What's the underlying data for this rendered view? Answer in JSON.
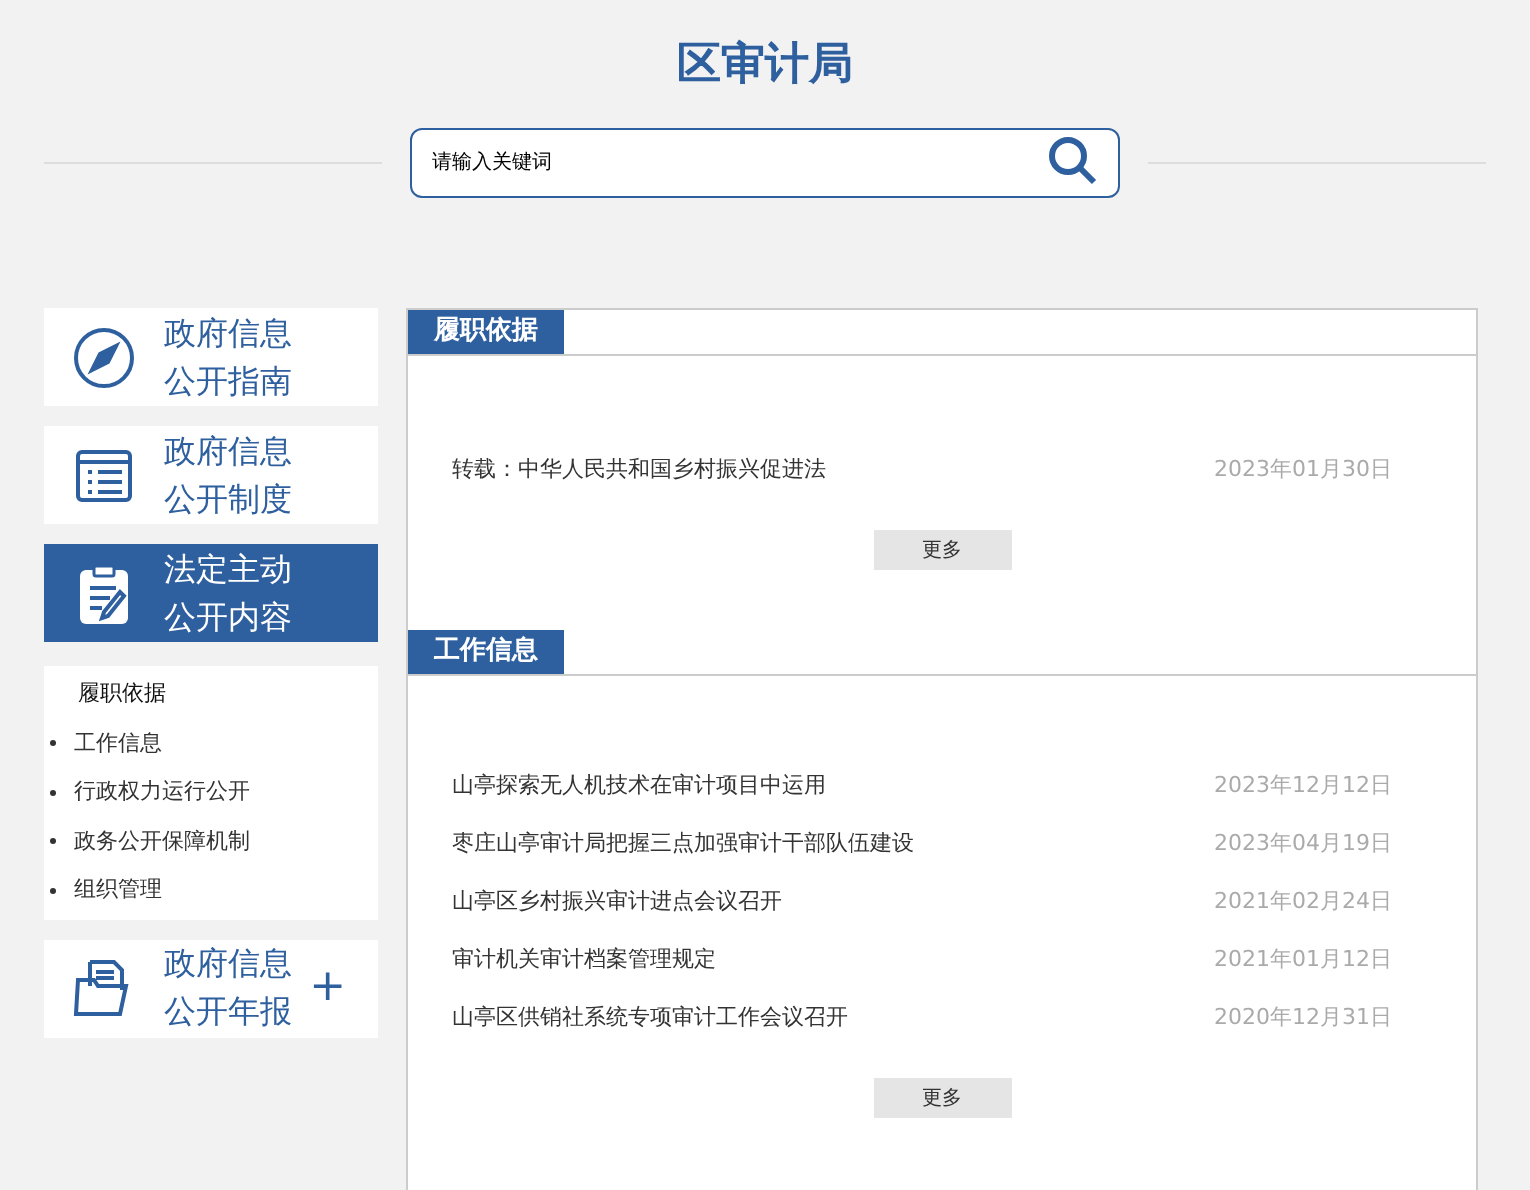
{
  "header": {
    "title": "区审计局"
  },
  "search": {
    "placeholder": "请输入关键词"
  },
  "sidebar": {
    "cards": [
      {
        "kind": "compass",
        "line1": "政府信息",
        "line2": "公开指南",
        "selected": false
      },
      {
        "kind": "list",
        "line1": "政府信息",
        "line2": "公开制度",
        "selected": false
      },
      {
        "kind": "clipboard",
        "line1": "法定主动",
        "line2": "公开内容",
        "selected": true,
        "submenu": [
          {
            "label": "履职依据",
            "selected": true
          },
          {
            "label": "工作信息",
            "selected": false
          },
          {
            "label": "行政权力运行公开",
            "selected": false
          },
          {
            "label": "政务公开保障机制",
            "selected": false
          },
          {
            "label": "组织管理",
            "selected": false
          }
        ]
      },
      {
        "kind": "folder",
        "line1": "政府信息",
        "line2": "公开年报",
        "selected": false,
        "toggle": "+"
      }
    ]
  },
  "sections": [
    {
      "title": "履职依据",
      "more": "更多",
      "items": [
        {
          "title": "转载：中华人民共和国乡村振兴促进法",
          "date": "2023年01月30日"
        }
      ]
    },
    {
      "title": "工作信息",
      "more": "更多",
      "items": [
        {
          "title": "山亭探索无人机技术在审计项目中运用",
          "date": "2023年12月12日"
        },
        {
          "title": "枣庄山亭审计局把握三点加强审计干部队伍建设",
          "date": "2023年04月19日"
        },
        {
          "title": "山亭区乡村振兴审计进点会议召开",
          "date": "2021年02月24日"
        },
        {
          "title": "审计机关审计档案管理规定",
          "date": "2021年01月12日"
        },
        {
          "title": "山亭区供销社系统专项审计工作会议召开",
          "date": "2020年12月31日"
        }
      ]
    }
  ]
}
